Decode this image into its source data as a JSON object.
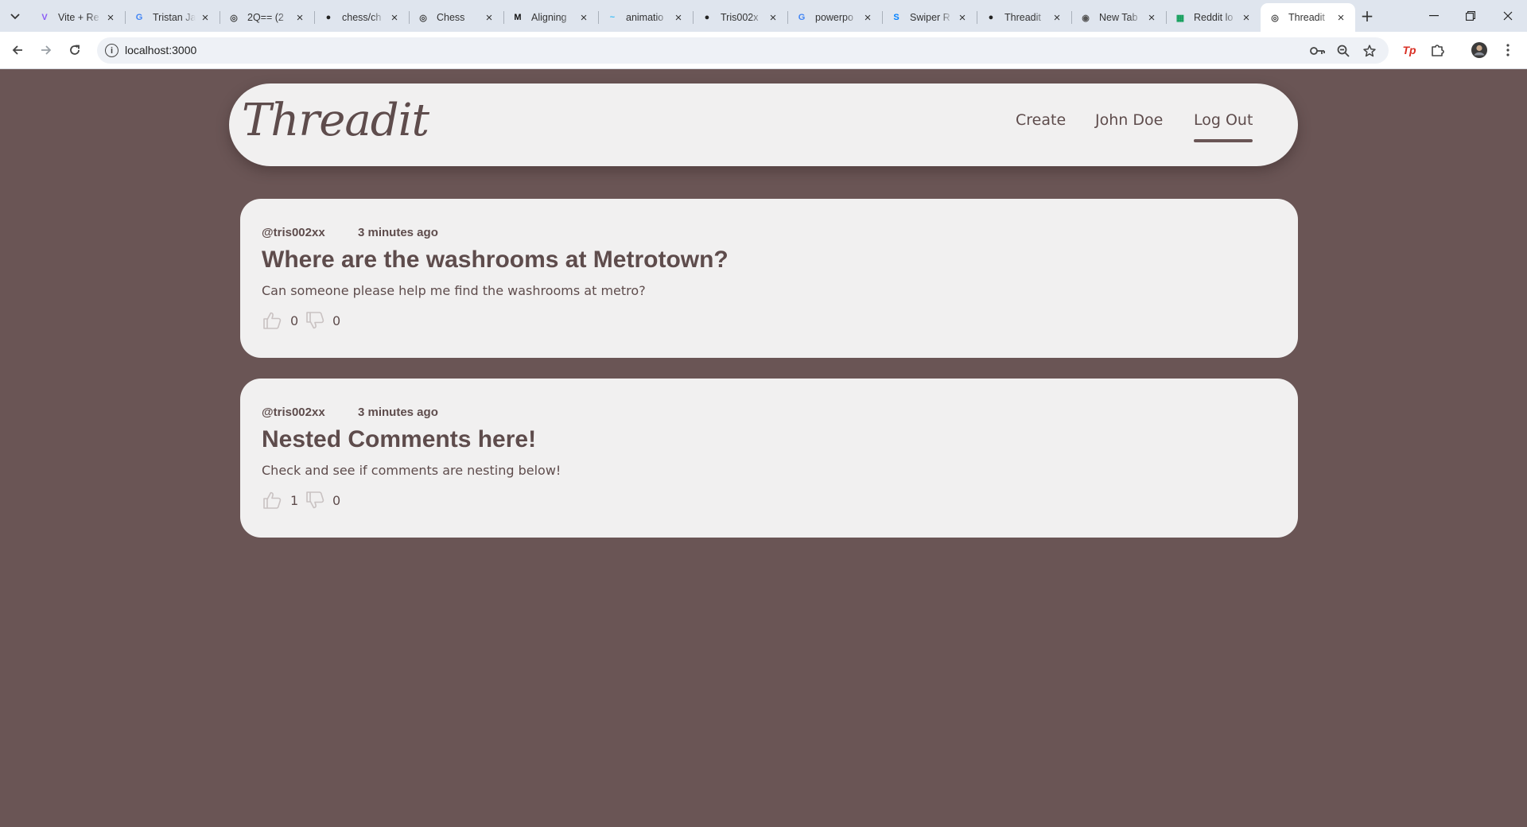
{
  "browser": {
    "tabs": [
      {
        "title": "Vite + Re",
        "icon": "vite-icon",
        "icon_color": "#8b5cf6"
      },
      {
        "title": "Tristan Ja",
        "icon": "google-icon",
        "icon_color": "#4285f4"
      },
      {
        "title": "2Q== (2",
        "icon": "globe-icon",
        "icon_color": "#444444"
      },
      {
        "title": "chess/ch",
        "icon": "github-icon",
        "icon_color": "#222222"
      },
      {
        "title": "Chess",
        "icon": "globe-icon",
        "icon_color": "#444444"
      },
      {
        "title": "Aligning",
        "icon": "medium-icon",
        "icon_color": "#111111"
      },
      {
        "title": "animatio",
        "icon": "tailwind-icon",
        "icon_color": "#38bdf8"
      },
      {
        "title": "Tris002x",
        "icon": "github-icon",
        "icon_color": "#222222"
      },
      {
        "title": "powerpo",
        "icon": "google-icon",
        "icon_color": "#4285f4"
      },
      {
        "title": "Swiper R",
        "icon": "swiper-icon",
        "icon_color": "#0080ff"
      },
      {
        "title": "Threadit",
        "icon": "github-icon",
        "icon_color": "#222222"
      },
      {
        "title": "New Tab",
        "icon": "chrome-icon",
        "icon_color": "#555555"
      },
      {
        "title": "Reddit lo",
        "icon": "sheets-icon",
        "icon_color": "#0f9d58"
      },
      {
        "title": "Threadit",
        "icon": "globe-icon",
        "icon_color": "#444444",
        "active": true
      }
    ],
    "url": "localhost:3000"
  },
  "header": {
    "logo": "Threadit",
    "nav": {
      "create": "Create",
      "user": "John Doe",
      "logout": "Log Out"
    }
  },
  "posts": [
    {
      "author": "@tris002xx",
      "time": "3 minutes ago",
      "title": "Where are the washrooms at Metrotown?",
      "body": "Can someone please help me find the washrooms at metro?",
      "likes": "0",
      "dislikes": "0"
    },
    {
      "author": "@tris002xx",
      "time": "3 minutes ago",
      "title": "Nested Comments here!",
      "body": "Check and see if comments are nesting below!",
      "likes": "1",
      "dislikes": "0"
    }
  ],
  "colors": {
    "page_background": "#6a5555",
    "card_background": "#f1f0f0",
    "text": "#5e4c4c"
  }
}
